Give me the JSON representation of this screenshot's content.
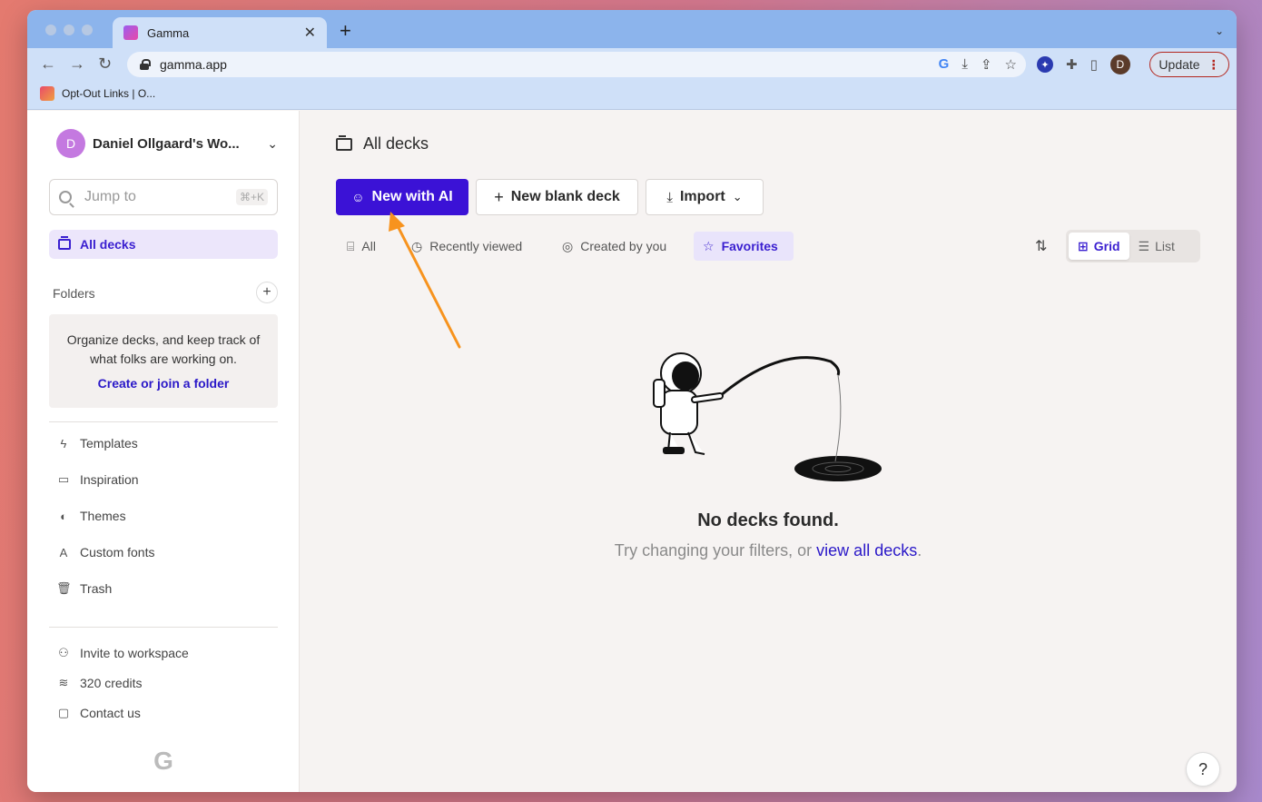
{
  "browser": {
    "tab_title": "Gamma",
    "url": "gamma.app",
    "bookmark": "Opt-Out Links | O...",
    "update_label": "Update",
    "profile_initial": "D"
  },
  "sidebar": {
    "workspace_initial": "D",
    "workspace_name": "Daniel Ollgaard's Wo...",
    "jump_placeholder": "Jump to",
    "jump_shortcut": "⌘+K",
    "all_decks": "All decks",
    "folders_title": "Folders",
    "folder_hint": "Organize decks, and keep track of what folks are working on.",
    "folder_link": "Create or join a folder",
    "nav": [
      {
        "label": "Templates",
        "icon": "lightning-icon"
      },
      {
        "label": "Inspiration",
        "icon": "book-icon"
      },
      {
        "label": "Themes",
        "icon": "palette-icon"
      },
      {
        "label": "Custom fonts",
        "icon": "font-icon"
      },
      {
        "label": "Trash",
        "icon": "trash-icon"
      }
    ],
    "bottom": [
      {
        "label": "Invite to workspace",
        "icon": "add-user-icon"
      },
      {
        "label": "320 credits",
        "icon": "coins-icon"
      },
      {
        "label": "Contact us",
        "icon": "chat-icon"
      }
    ]
  },
  "main": {
    "title": "All decks",
    "new_ai": "New with AI",
    "new_blank": "New blank deck",
    "import": "Import",
    "filters": [
      {
        "label": "All",
        "active": false
      },
      {
        "label": "Recently viewed",
        "active": false
      },
      {
        "label": "Created by you",
        "active": false
      },
      {
        "label": "Favorites",
        "active": true
      }
    ],
    "view_grid": "Grid",
    "view_list": "List",
    "empty_title": "No decks found.",
    "empty_sub_prefix": "Try changing your filters, or ",
    "empty_sub_link": "view all decks",
    "empty_sub_suffix": ".",
    "help": "?"
  },
  "colors": {
    "accent": "#3b12d6",
    "annotation_arrow": "#f7931e"
  }
}
